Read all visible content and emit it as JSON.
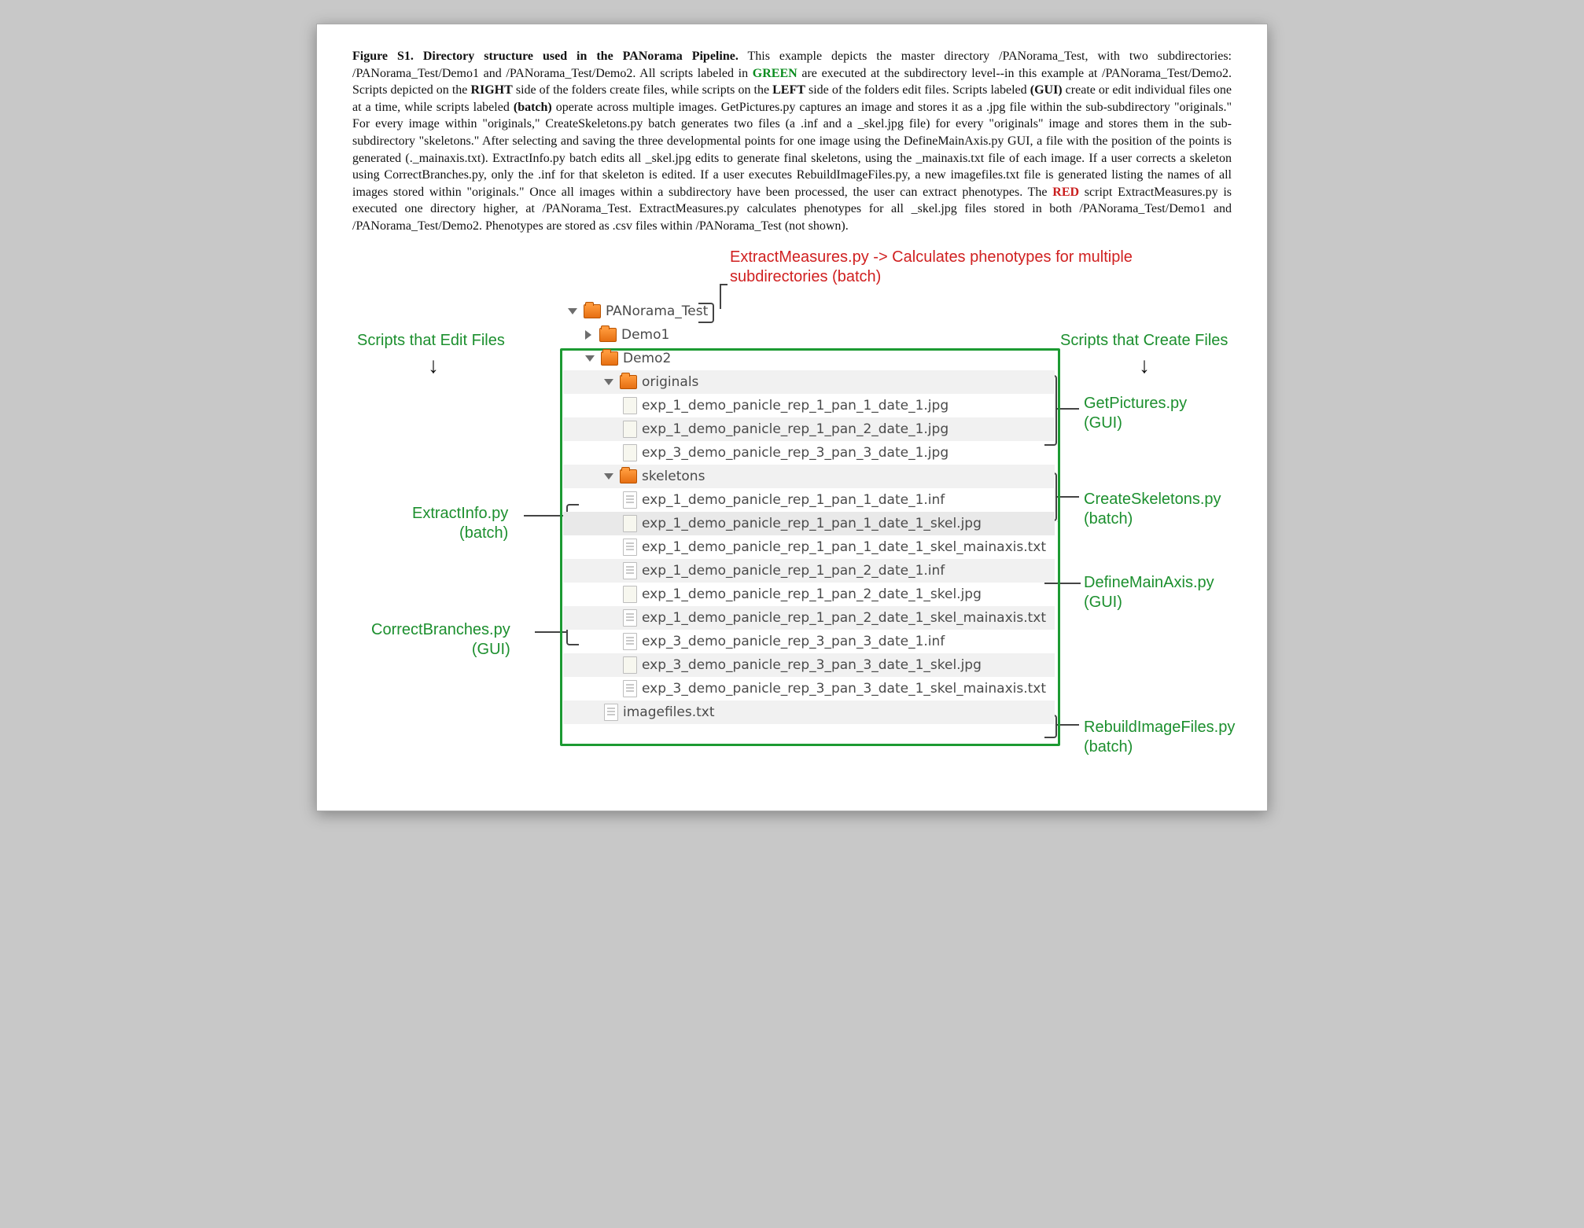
{
  "figure_caption": {
    "lead": "Figure S1.  Directory structure used in the PANorama Pipeline.",
    "body_1": " This example depicts the master directory /PANorama_Test, with two subdirectories: /PANorama_Test/Demo1 and /PANorama_Test/Demo2.  All scripts labeled in ",
    "green_word": "GREEN",
    "body_2": " are executed at the subdirectory level--in this example at /PANorama_Test/Demo2.  Scripts depicted on the ",
    "right_word": "RIGHT",
    "body_3": " side of the folders create files, while scripts on the ",
    "left_word": "LEFT",
    "body_4": " side of the folders edit files.  Scripts labeled ",
    "gui_word": "(GUI)",
    "body_5": " create or edit individual files one at a time, while scripts labeled ",
    "batch_word": "(batch)",
    "body_6": " operate across multiple images.   GetPictures.py captures an image and stores it as a .jpg file within the sub-subdirectory \"originals.\"  For every image within \"originals,\" CreateSkeletons.py batch generates two files (a .inf and a _skel.jpg file) for every \"originals\" image and stores them in the sub-subdirectory \"skeletons.\"  After selecting and saving the three developmental points for one image using the DefineMainAxis.py GUI, a file with the position of the points is generated (._mainaxis.txt).  ExtractInfo.py batch edits all _skel.jpg edits to generate final skeletons, using the _mainaxis.txt file of each image.  If a user corrects a skeleton using CorrectBranches.py, only the .inf for that skeleton is edited.  If a user executes RebuildImageFiles.py, a new imagefiles.txt file is generated listing the names of all images stored within \"originals.\"  Once all images within a subdirectory have been processed, the user can extract phenotypes.  The ",
    "red_word": "RED",
    "body_7": " script ExtractMeasures.py is executed one directory higher, at /PANorama_Test.  ExtractMeasures.py calculates phenotypes for all _skel.jpg files stored in both /PANorama_Test/Demo1 and /PANorama_Test/Demo2.  Phenotypes are stored as .csv files within /PANorama_Test (not shown)."
  },
  "labels": {
    "extract_measures": "ExtractMeasures.py -> Calculates phenotypes for multiple subdirectories (batch)",
    "edit_header": "Scripts that Edit Files",
    "create_header": "Scripts that Create Files",
    "get_pictures": "GetPictures.py\n(GUI)",
    "create_skeletons": "CreateSkeletons.py\n(batch)",
    "define_main_axis": "DefineMainAxis.py\n(GUI)",
    "rebuild_image_files": "RebuildImageFiles.py\n(batch)",
    "extract_info": "ExtractInfo.py\n(batch)",
    "correct_branches": "CorrectBranches.py\n(GUI)"
  },
  "tree": {
    "root": "PANorama_Test",
    "demo1": "Demo1",
    "demo2": "Demo2",
    "originals": "originals",
    "skeletons": "skeletons",
    "imagefiles": "imagefiles.txt",
    "orig_files": [
      "exp_1_demo_panicle_rep_1_pan_1_date_1.jpg",
      "exp_1_demo_panicle_rep_1_pan_2_date_1.jpg",
      "exp_3_demo_panicle_rep_3_pan_3_date_1.jpg"
    ],
    "skel_files": [
      "exp_1_demo_panicle_rep_1_pan_1_date_1.inf",
      "exp_1_demo_panicle_rep_1_pan_1_date_1_skel.jpg",
      "exp_1_demo_panicle_rep_1_pan_1_date_1_skel_mainaxis.txt",
      "exp_1_demo_panicle_rep_1_pan_2_date_1.inf",
      "exp_1_demo_panicle_rep_1_pan_2_date_1_skel.jpg",
      "exp_1_demo_panicle_rep_1_pan_2_date_1_skel_mainaxis.txt",
      "exp_3_demo_panicle_rep_3_pan_3_date_1.inf",
      "exp_3_demo_panicle_rep_3_pan_3_date_1_skel.jpg",
      "exp_3_demo_panicle_rep_3_pan_3_date_1_skel_mainaxis.txt"
    ]
  }
}
